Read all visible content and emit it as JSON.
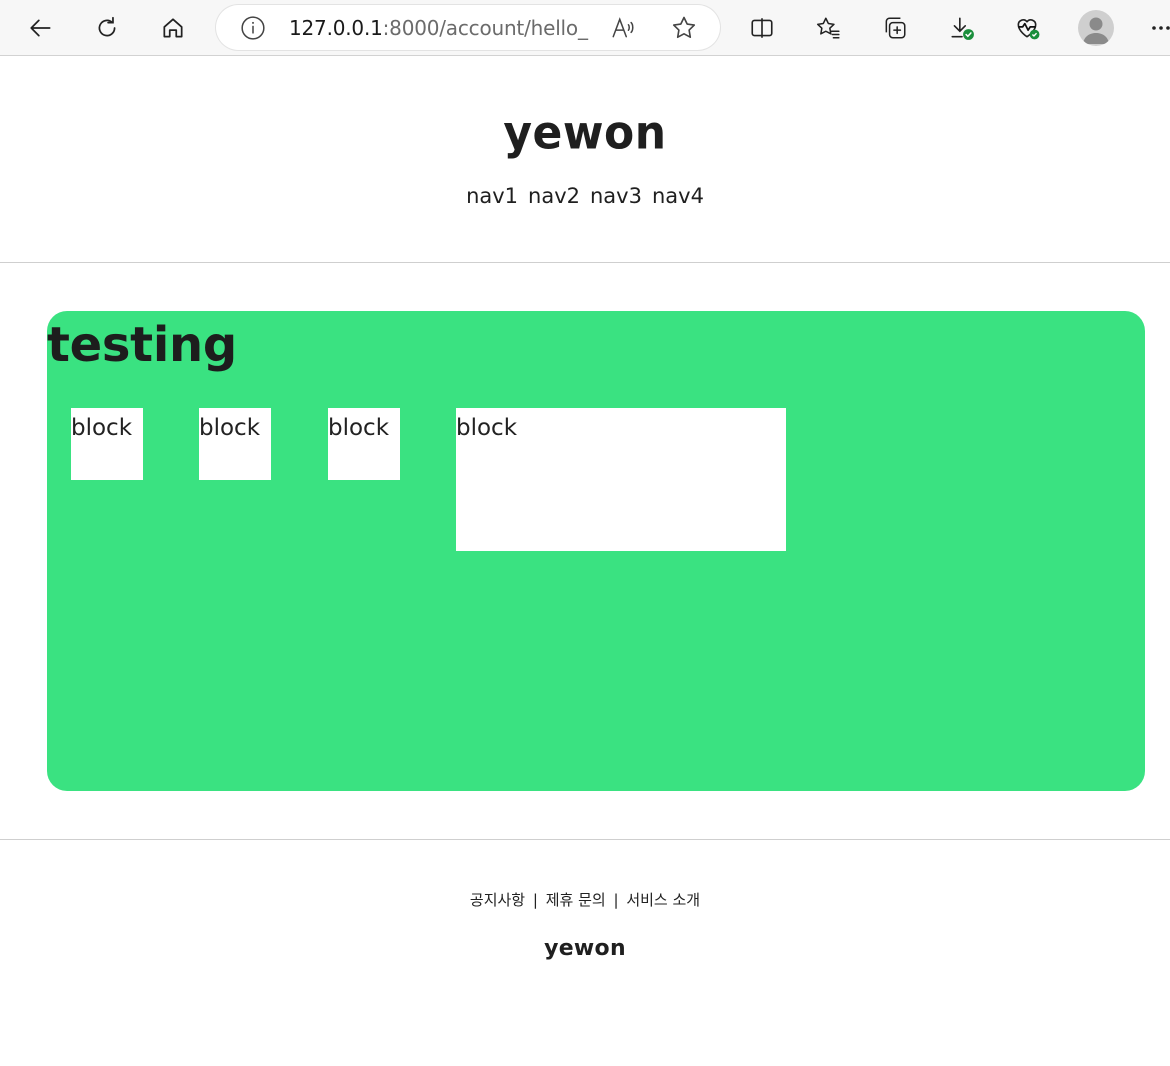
{
  "browser": {
    "url_host": "127.0.0.1",
    "url_rest": ":8000/account/hello_..."
  },
  "site": {
    "logo": "yewon",
    "nav": [
      "nav1",
      "nav2",
      "nav3",
      "nav4"
    ]
  },
  "main": {
    "title": "testing",
    "blocks": [
      "block",
      "block",
      "block",
      "block"
    ],
    "accent_color": "#3ae281"
  },
  "footer": {
    "links": [
      "공지사항",
      "제휴 문의",
      "서비스 소개"
    ],
    "separator": "|",
    "logo": "yewon"
  }
}
